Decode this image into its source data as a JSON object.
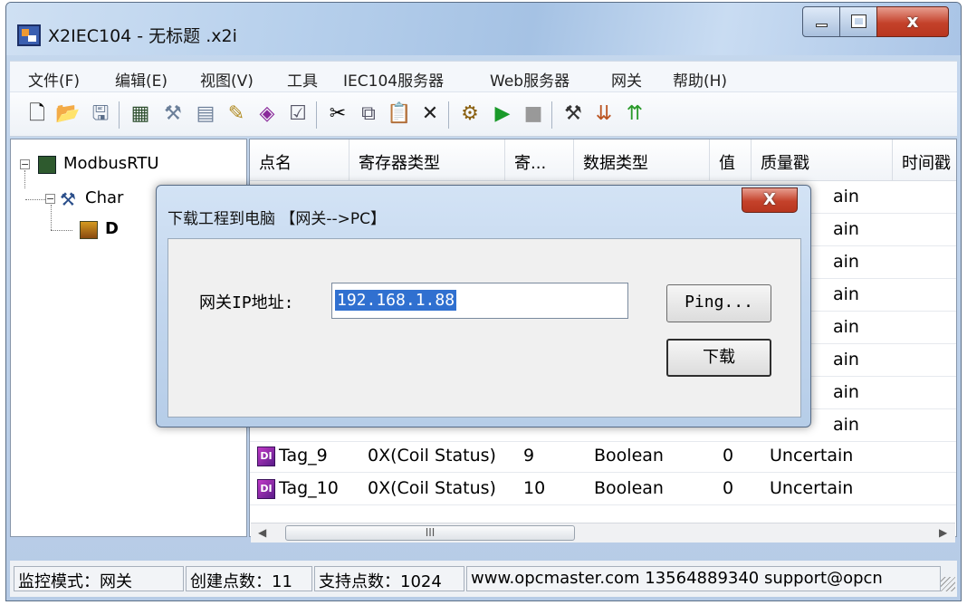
{
  "window": {
    "title": "X2IEC104 - 无标题 .x2i"
  },
  "menu": [
    "文件(F)",
    "编辑(E)",
    "视图(V)",
    "工具",
    "IEC104服务器",
    "Web服务器",
    "网关",
    "帮助(H)"
  ],
  "toolbar": {
    "icons": [
      "new-file",
      "open-folder",
      "save",
      "add-device",
      "add-channel",
      "properties",
      "add-tag",
      "add-multiple-tags",
      "tag-properties",
      "cut",
      "copy",
      "paste",
      "delete",
      "config",
      "run",
      "stop",
      "tools",
      "load",
      "upload"
    ]
  },
  "tree": {
    "root": "ModbusRTU",
    "channel": "Char",
    "device": "D"
  },
  "table": {
    "columns": [
      "点名",
      "寄存器类型",
      "寄...",
      "数据类型",
      "值",
      "质量戳",
      "时间戳"
    ],
    "visible_quality_fragments": [
      "ain",
      "ain",
      "ain",
      "ain",
      "ain",
      "ain",
      "ain",
      "ain"
    ],
    "rows": [
      {
        "name": "Tag_9",
        "register": "0X(Coil Status)",
        "address": "9",
        "datatype": "Boolean",
        "value": "0",
        "quality": "Uncertain"
      },
      {
        "name": "Tag_10",
        "register": "0X(Coil Status)",
        "address": "10",
        "datatype": "Boolean",
        "value": "0",
        "quality": "Uncertain"
      }
    ],
    "scroll_thumb": "III"
  },
  "status": {
    "mode": "监控模式：网关",
    "created": "创建点数：11",
    "supported": "支持点数：1024",
    "contact": "www.opcmaster.com 13564889340 support@opcn"
  },
  "dialog": {
    "title": "下载工程到电脑 【网关-->PC】",
    "close": "X",
    "ip_label": "网关IP地址:",
    "ip_value": "192.168.1.88",
    "ping_button": "Ping...",
    "download_button": "下载"
  }
}
